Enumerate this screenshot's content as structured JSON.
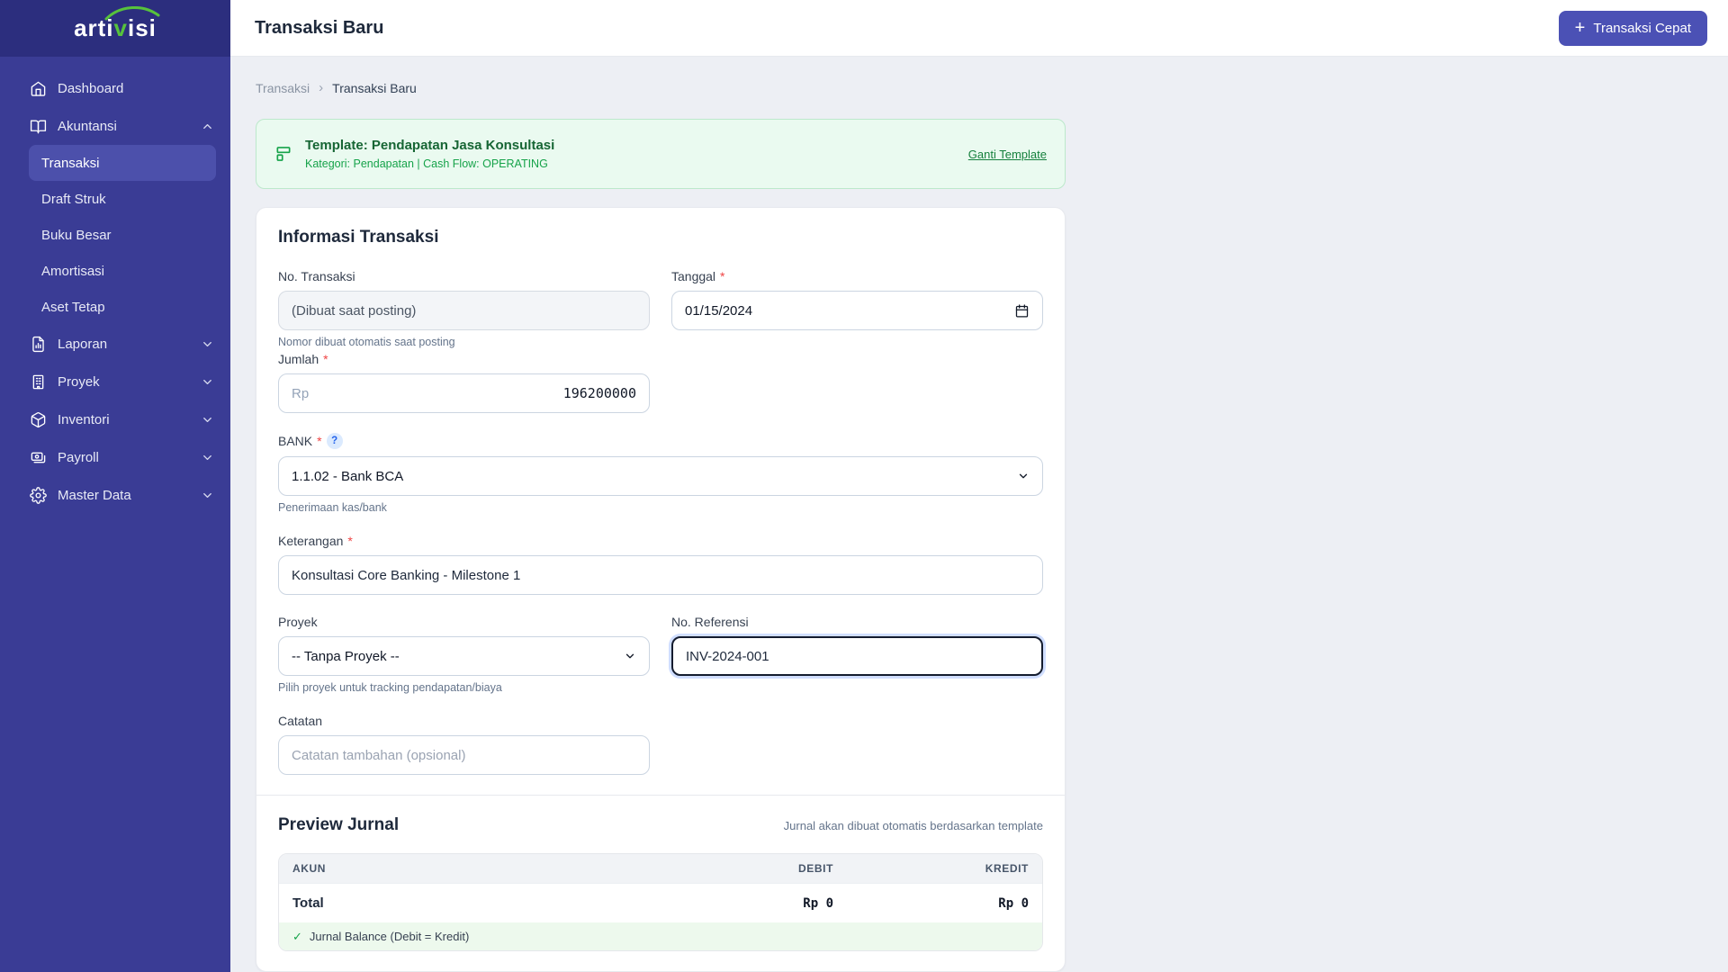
{
  "sidebar": {
    "logo": {
      "pre": "arti",
      "mid": "v",
      "post": "isi"
    },
    "items": [
      {
        "label": "Dashboard",
        "icon": "home-icon"
      },
      {
        "label": "Akuntansi",
        "icon": "book-icon",
        "state": "expanded"
      },
      {
        "label": "Laporan",
        "icon": "report-icon"
      },
      {
        "label": "Proyek",
        "icon": "building-icon"
      },
      {
        "label": "Inventori",
        "icon": "cube-icon"
      },
      {
        "label": "Payroll",
        "icon": "payroll-icon"
      },
      {
        "label": "Master Data",
        "icon": "gear-icon"
      }
    ],
    "akuntansi_submenu": [
      "Transaksi",
      "Draft Struk",
      "Buku Besar",
      "Amortisasi",
      "Aset Tetap"
    ],
    "active_item": "Transaksi"
  },
  "header": {
    "title": "Transaksi Baru",
    "quick_button": {
      "plus": "+",
      "label": "Transaksi Cepat"
    }
  },
  "breadcrumb": {
    "parent": "Transaksi",
    "separator": "›",
    "current": "Transaksi Baru"
  },
  "template_banner": {
    "title": "Template: Pendapatan Jasa Konsultasi",
    "subtitle": "Kategori: Pendapatan | Cash Flow: OPERATING",
    "action": "Ganti Template",
    "accent_color": "#16a34a"
  },
  "form": {
    "section_title": "Informasi Transaksi",
    "no_transaksi": {
      "label": "No. Transaksi",
      "value": "(Dibuat saat posting)",
      "helper": "Nomor dibuat otomatis saat posting"
    },
    "tanggal": {
      "label": "Tanggal",
      "required": "*",
      "value": "01/15/2024"
    },
    "jumlah": {
      "label": "Jumlah",
      "required": "*",
      "prefix": "Rp",
      "value": "196200000"
    },
    "bank": {
      "label": "BANK",
      "required": "*",
      "badge": "?",
      "selected": "1.1.02 - Bank BCA",
      "helper": "Penerimaan kas/bank"
    },
    "keterangan": {
      "label": "Keterangan",
      "required": "*",
      "value": "Konsultasi Core Banking - Milestone 1"
    },
    "proyek": {
      "label": "Proyek",
      "selected": "-- Tanpa Proyek --",
      "helper": "Pilih proyek untuk tracking pendapatan/biaya"
    },
    "referensi": {
      "label": "No. Referensi",
      "value": "INV-2024-001",
      "focused": true
    },
    "catatan": {
      "label": "Catatan",
      "placeholder": "Catatan tambahan (opsional)"
    }
  },
  "preview": {
    "title": "Preview Jurnal",
    "note": "Jurnal akan dibuat otomatis berdasarkan template",
    "table": {
      "headers": [
        "AKUN",
        "DEBIT",
        "KREDIT"
      ],
      "total_label": "Total",
      "total_debit": "Rp 0",
      "total_kredit": "Rp 0"
    },
    "balance": {
      "check": "✓",
      "text": "Jurnal Balance (Debit = Kredit)"
    }
  }
}
